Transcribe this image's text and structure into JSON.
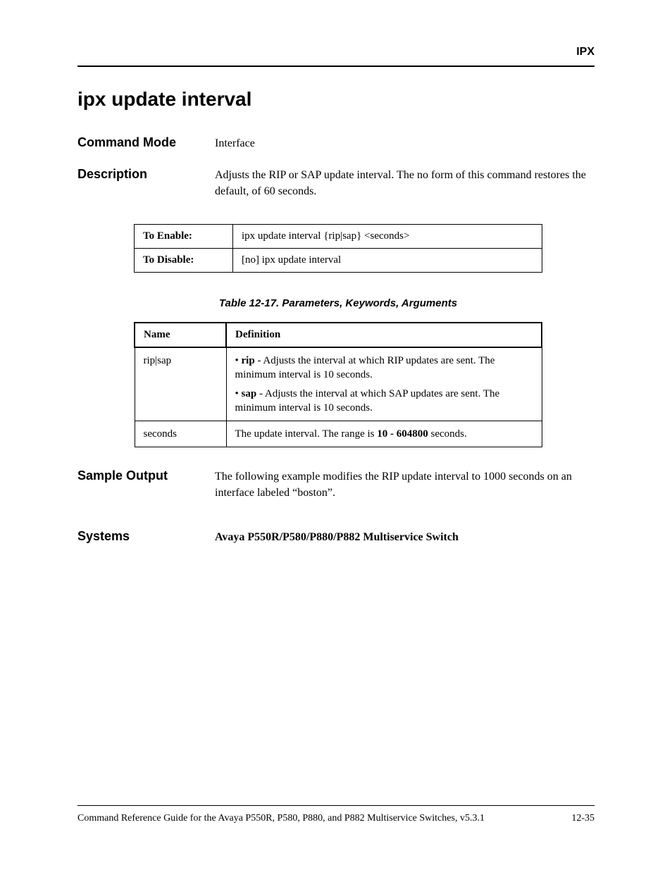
{
  "header": {
    "section_label": "IPX"
  },
  "title": "ipx update interval",
  "command_mode": {
    "label": "Command Mode",
    "value": "Interface"
  },
  "description": {
    "label": "Description",
    "value": "Adjusts the RIP or SAP update interval. The no form of this command restores the default, of 60 seconds."
  },
  "syntax": {
    "enable": {
      "label": "To Enable:",
      "value": "ipx update interval {rip|sap} <seconds>"
    },
    "disable": {
      "label": "To Disable:",
      "value": "[no] ipx update interval"
    }
  },
  "params_caption": "Table 12-17.  Parameters, Keywords, Arguments",
  "params_headers": {
    "name": "Name",
    "definition": "Definition"
  },
  "params": {
    "row1": {
      "name": "rip|sap",
      "def1_bold": "rip",
      "def1_rest": " - Adjusts the interval at which RIP updates are sent. The minimum interval is 10 seconds.",
      "def2_bold": "sap",
      "def2_rest": " - Adjusts the interval at which SAP updates are sent. The minimum interval is 10 seconds."
    },
    "row2": {
      "name": "seconds",
      "def_pre": "The update interval. The range is ",
      "def_bold": "10 - 604800",
      "def_post": " seconds."
    }
  },
  "sample_output": {
    "label": "Sample Output",
    "value": "The following example modifies the RIP update interval to 1000 seconds on an interface labeled “boston”."
  },
  "systems": {
    "label": "Systems",
    "value": "Avaya P550R/P580/P880/P882 Multiservice Switch"
  },
  "footer": {
    "guide": "Command Reference Guide for the Avaya P550R, P580, P880, and P882 Multiservice Switches, v5.3.1",
    "page": "12-35"
  }
}
